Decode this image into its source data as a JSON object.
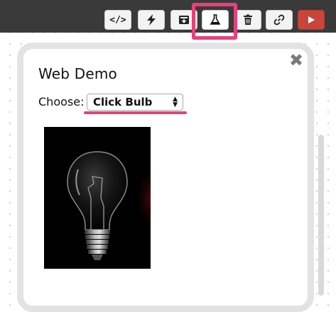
{
  "toolbar": {
    "buttons": [
      {
        "name": "code",
        "label": "</>"
      },
      {
        "name": "run-action",
        "icon": "bolt-icon"
      },
      {
        "name": "save-download",
        "icon": "download-box-icon"
      },
      {
        "name": "test-flask",
        "icon": "flask-icon"
      },
      {
        "name": "delete",
        "icon": "trash-icon"
      },
      {
        "name": "link",
        "icon": "link-icon"
      },
      {
        "name": "play",
        "icon": "play-icon"
      }
    ],
    "highlight_color": "#ea3f7b",
    "run_color": "#c9453b"
  },
  "panel": {
    "title": "Web Demo",
    "close_glyph": "✖",
    "choose_label": "Choose:",
    "select_value": "Click Bulb",
    "image_description_icon": "light-bulb-image"
  }
}
